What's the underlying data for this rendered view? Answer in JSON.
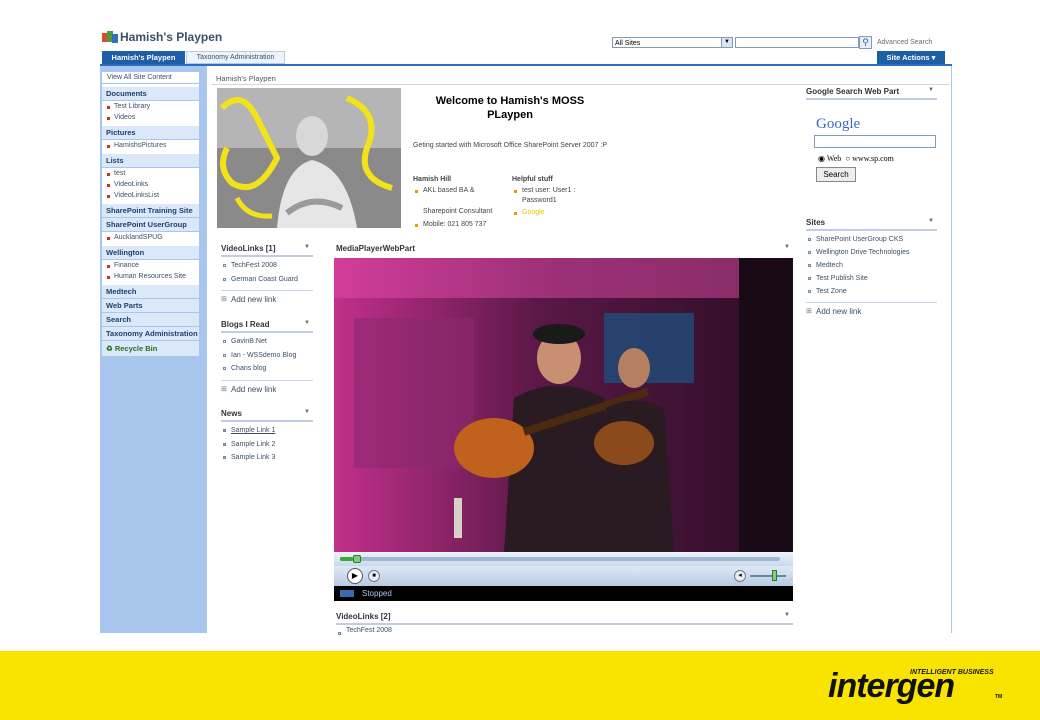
{
  "site": {
    "title": "Hamish's Playpen"
  },
  "header": {
    "scope_value": "All Sites",
    "search_placeholder": "",
    "advanced_search": "Advanced Search",
    "tabs": [
      {
        "label": "Hamish's Playpen"
      },
      {
        "label": "Taxonomy Administration"
      }
    ],
    "site_actions": "Site Actions ▾"
  },
  "nav": {
    "view_all": "View All Site Content",
    "sections": [
      {
        "heading": "Documents",
        "items": [
          "Test Library",
          "Videos"
        ]
      },
      {
        "heading": "Pictures",
        "items": [
          "HamishsPictures"
        ]
      },
      {
        "heading": "Lists",
        "items": [
          "test",
          "VideoLinks",
          "VideoLinksList"
        ]
      },
      {
        "heading": "SharePoint Training Site",
        "items": []
      },
      {
        "heading": "SharePoint UserGroup",
        "items": [
          "AucklandSPUG"
        ]
      },
      {
        "heading": "Wellington",
        "items": [
          "Finance",
          "Human Resources Site"
        ]
      },
      {
        "heading": "Medtech",
        "items": []
      },
      {
        "heading": "Web Parts",
        "items": []
      },
      {
        "heading": "Search",
        "items": []
      },
      {
        "heading": "Taxonomy Administration",
        "items": []
      }
    ],
    "recycle_bin": "Recycle Bin"
  },
  "breadcrumb": "Hamish's Playpen",
  "welcome": {
    "title": "Welcome to Hamish's MOSS PLaypen",
    "getting_started": "Geting started with Microsoft Office SharePoint Server 2007 :P",
    "left_heading": "Hamish Hill",
    "left_items": [
      "AKL based BA &",
      "Sharepoint Consultant",
      "Mobile: 021 805 737"
    ],
    "right_heading": "Helpful stuff",
    "right_items": [
      "test user: User1 : Password1",
      "Google"
    ]
  },
  "videolinks1": {
    "title": "VideoLinks [1]",
    "items": [
      "TechFest 2008",
      "German Coast Guard"
    ],
    "add": "Add new link"
  },
  "blogs": {
    "title": "Blogs I Read",
    "items": [
      "GavinB.Net",
      "Ian - WSSdemo Blog",
      "Chans blog"
    ],
    "add": "Add new link"
  },
  "news": {
    "title": "News",
    "items": [
      "Sample Link 1",
      "Sample Link 2",
      "Sample Link 3"
    ]
  },
  "media": {
    "title": "MediaPlayerWebPart",
    "status": "Stopped",
    "progress": 0.03,
    "volume": 0.6
  },
  "videolinks2": {
    "title": "VideoLinks [2]",
    "items": [
      "TechFest 2008"
    ]
  },
  "google": {
    "title": "Google Search Web Part",
    "logo": "Google",
    "opt_web": "Web",
    "opt_site": "www.sp.com",
    "button": "Search"
  },
  "sites": {
    "title": "Sites",
    "items": [
      "SharePoint UserGroup CKS",
      "Wellington Drive Technologies",
      "Medtech",
      "Test Publish Site",
      "Test Zone"
    ],
    "add": "Add new link"
  },
  "footer": {
    "brand": "intergen",
    "tagline": "INTELLIGENT BUSINESS",
    "tm": "TM"
  },
  "colors": {
    "accent": "#1c5fa7",
    "nav_bg": "#a9c6ef",
    "footer": "#f9e300"
  }
}
